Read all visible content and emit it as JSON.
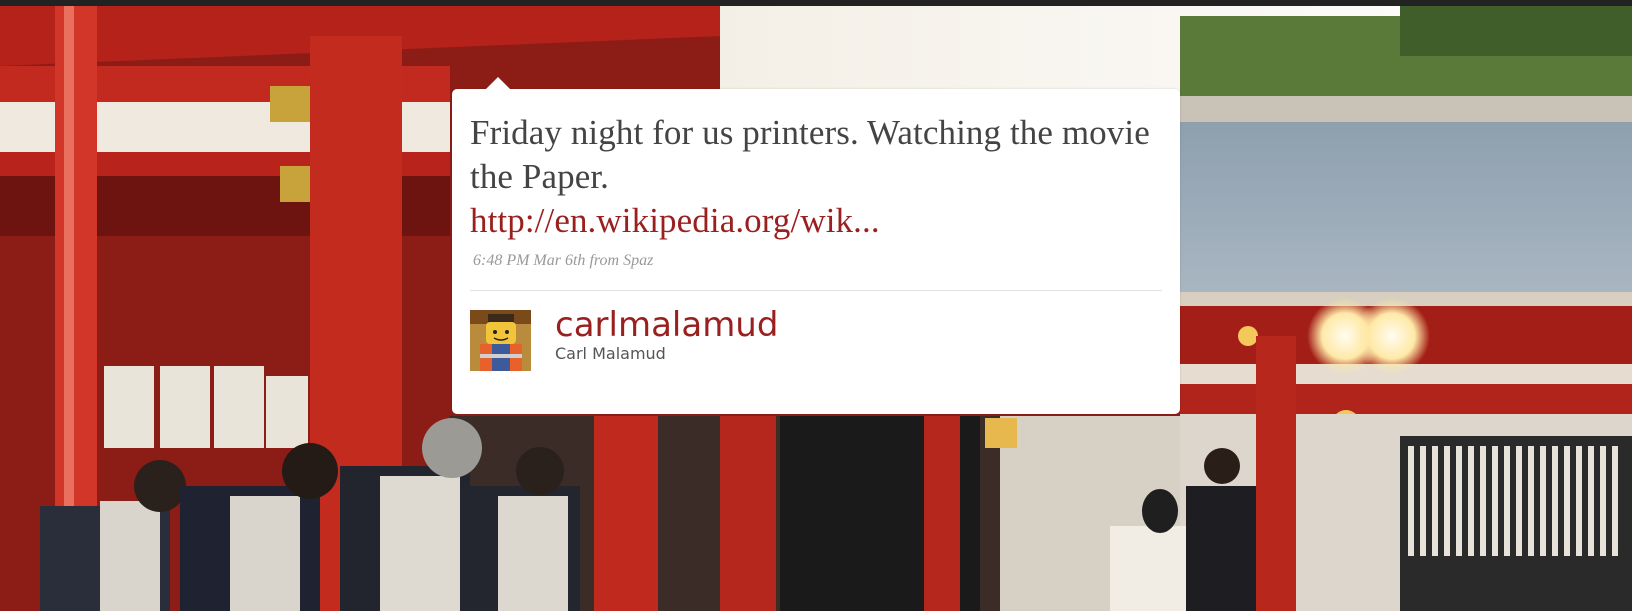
{
  "tweet": {
    "text": "Friday night for us printers. Watching the movie the Paper.",
    "link": "http://en.wikipedia.org/wik...",
    "time": "6:48 PM Mar 6th",
    "source_prefix": "from",
    "source": "Spaz"
  },
  "author": {
    "handle": "carlmalamud",
    "name": "Carl Malamud",
    "avatar_icon": "lego-figure-avatar-icon"
  },
  "background": {
    "icon": "shrine-ceremony-photo"
  },
  "colors": {
    "link": "#9a1f1f",
    "text": "#444444",
    "meta": "#999999",
    "card": "#ffffff"
  }
}
